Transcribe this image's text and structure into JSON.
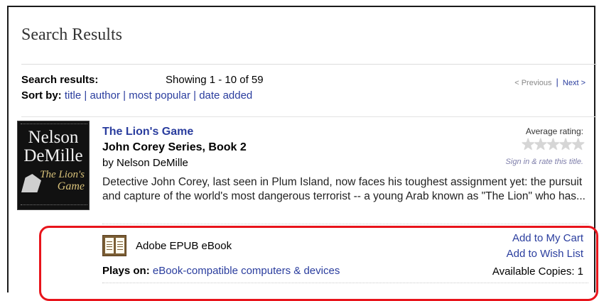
{
  "page": {
    "title": "Search Results"
  },
  "results": {
    "label": "Search results:",
    "showing": "Showing 1 - 10 of 59"
  },
  "sort": {
    "label": "Sort by:",
    "options": [
      "title",
      "author",
      "most popular",
      "date added"
    ],
    "separator": "|"
  },
  "pager": {
    "previous": "< Previous",
    "separator": "|",
    "next": "Next >"
  },
  "book": {
    "cover": {
      "author_line1": "Nelson",
      "author_line2": "DeMille",
      "title_line1": "The Lion's",
      "title_line2": "Game"
    },
    "title": "The Lion's Game",
    "series": "John Corey Series, Book 2",
    "author": "by Nelson DeMille",
    "rating": {
      "label": "Average rating:",
      "stars": "★★★★★",
      "value": 0,
      "max": 5,
      "sign_in": "Sign in & rate this title."
    },
    "description": "Detective John Corey, last seen in Plum Island, now faces his toughest assignment yet: the pursuit and capture of the world's most dangerous terrorist -- a young Arab known as \"The Lion\" who has...",
    "format": "Adobe EPUB eBook",
    "format_icon": "epub-book-icon",
    "plays_on_label": "Plays on:",
    "plays_on_value": "eBook-compatible computers & devices",
    "add_to_cart": "Add to My Cart",
    "add_to_wishlist": "Add to Wish List",
    "available_copies": "Available Copies: 1"
  },
  "colors": {
    "link": "#2a3d9e",
    "highlight": "#e8141b",
    "icon_brown": "#7a5d34"
  }
}
